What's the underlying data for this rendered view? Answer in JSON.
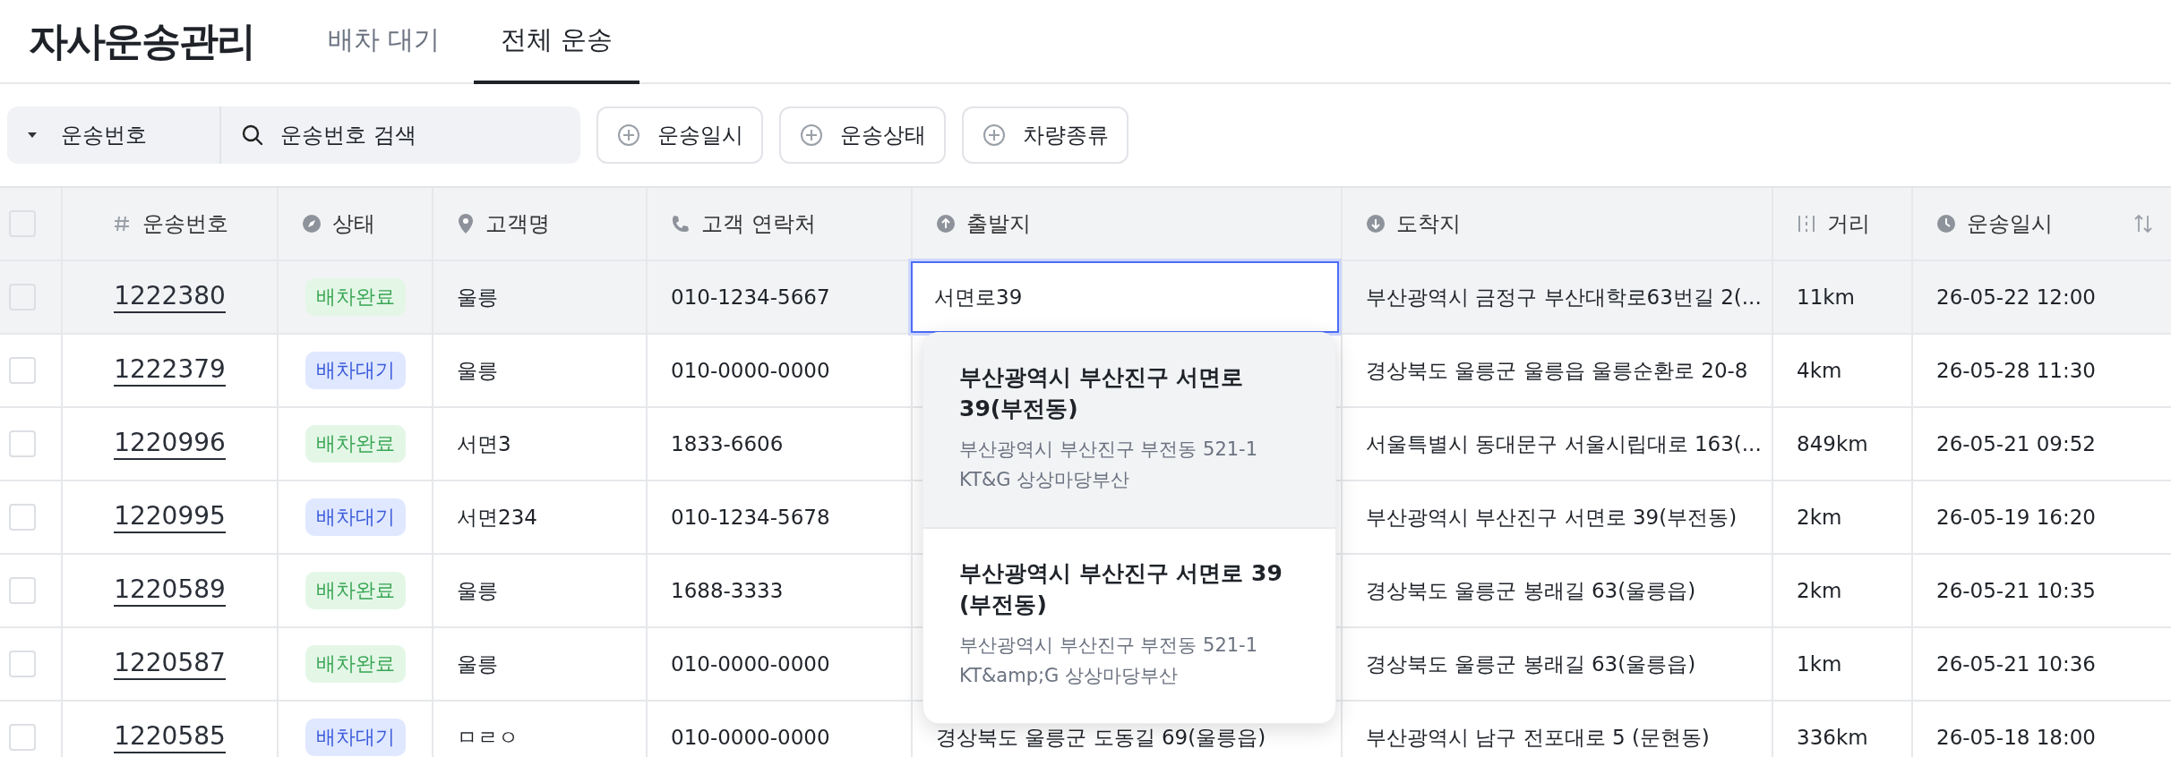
{
  "app": {
    "title": "자사운송관리"
  },
  "tabs": [
    {
      "label": "배차 대기",
      "selected": false
    },
    {
      "label": "전체 운송",
      "selected": true
    }
  ],
  "filter": {
    "field_select": "운송번호",
    "search_placeholder": "운송번호 검색",
    "buttons": [
      "운송일시",
      "운송상태",
      "차량종류"
    ]
  },
  "table": {
    "header_checked": false,
    "columns": [
      "운송번호",
      "상태",
      "고객명",
      "고객 연락처",
      "출발지",
      "도착지",
      "거리",
      "운송일시"
    ],
    "rows": [
      {
        "selected": true,
        "checked": false,
        "number": "1222380",
        "status": "배차완료",
        "kind": "done",
        "customer": "울릉",
        "phone": "010-1234-5667",
        "departure_input": "서면로39",
        "destination": "부산광역시 금정구 부산대학로63번길 2(...",
        "distance": "11km",
        "date": "26-05-22 12:00"
      },
      {
        "selected": false,
        "checked": false,
        "number": "1222379",
        "status": "배차대기",
        "kind": "waiting",
        "customer": "울릉",
        "phone": "010-0000-0000",
        "destination": "경상북도 울릉군 울릉읍 울릉순환로 20-8",
        "distance": "4km",
        "date": "26-05-28 11:30"
      },
      {
        "selected": false,
        "checked": false,
        "number": "1220996",
        "status": "배차완료",
        "kind": "done",
        "customer": "서면3",
        "phone": "1833-6606",
        "destination": "서울특별시 동대문구 서울시립대로 163(...",
        "distance": "849km",
        "date": "26-05-21 09:52"
      },
      {
        "selected": false,
        "checked": false,
        "number": "1220995",
        "status": "배차대기",
        "kind": "waiting",
        "customer": "서면234",
        "phone": "010-1234-5678",
        "destination": "부산광역시 부산진구 서면로 39(부전동)",
        "distance": "2km",
        "date": "26-05-19 16:20"
      },
      {
        "selected": false,
        "checked": false,
        "number": "1220589",
        "status": "배차완료",
        "kind": "done",
        "customer": "울릉",
        "phone": "1688-3333",
        "destination": "경상북도 울릉군 봉래길 63(울릉읍)",
        "distance": "2km",
        "date": "26-05-21 10:35"
      },
      {
        "selected": false,
        "checked": false,
        "number": "1220587",
        "status": "배차완료",
        "kind": "done",
        "customer": "울릉",
        "phone": "010-0000-0000",
        "destination": "경상북도 울릉군 봉래길 63(울릉읍)",
        "distance": "1km",
        "date": "26-05-21 10:36"
      },
      {
        "selected": false,
        "checked": false,
        "number": "1220585",
        "status": "배차대기",
        "kind": "waiting",
        "customer": "ㅁㄹㅇ",
        "phone": "010-0000-0000",
        "departure": "경상북도 울릉군 도동길 69(울릉읍)",
        "destination": "부산광역시 남구 전포대로 5 (문현동)",
        "distance": "336km",
        "date": "26-05-18 18:00"
      }
    ]
  },
  "suggestions": [
    {
      "selected": true,
      "title": "부산광역시 부산진구 서면로 39(부전동)",
      "subtitle": "부산광역시 부산진구 부전동 521-1 KT&G 상상마당부산"
    },
    {
      "selected": false,
      "title": "부산광역시 부산진구 서면로 39 (부전동)",
      "subtitle": "부산광역시 부산진구 부전동 521-1 KT&amp;G 상상마당부산"
    }
  ]
}
